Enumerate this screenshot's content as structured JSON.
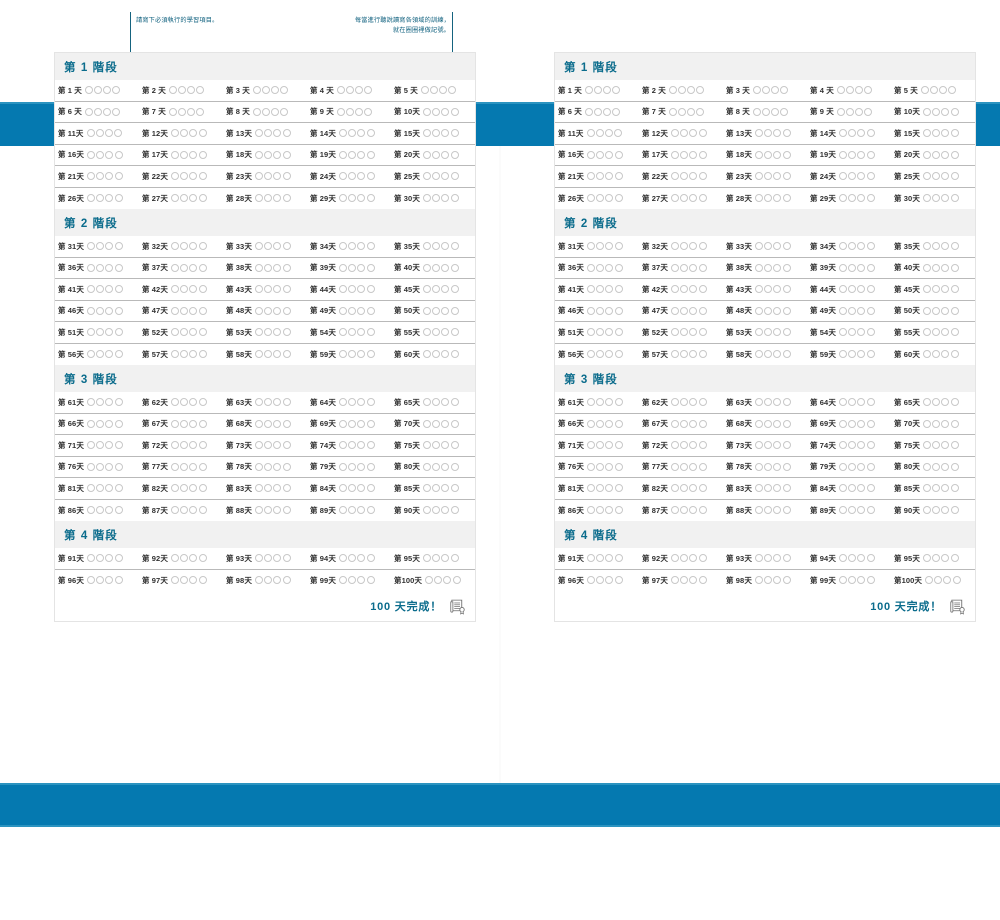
{
  "theme": {
    "band_blue": "#0579b0",
    "band_edge": "#2b93c0",
    "heading_teal": "#0b6c8c",
    "annotation_teal": "#0d5f7d",
    "stage_header_bg": "#f1f1f1",
    "circle_border": "#c8c8c8",
    "row_rule": "#b9b9b9",
    "day_text": "#303030"
  },
  "annotations": {
    "left_note": "請寫下必須執行的學習項目。",
    "right_note": "每當進行聽說讀寫各領域的訓練，\n就在圈圈裡做記號。"
  },
  "tracker": {
    "marks_per_day": 4,
    "footer_text": "100 天完成！",
    "footer_icon": "certificate-icon",
    "day_prefix": "第",
    "day_suffix": "天",
    "stages": [
      {
        "label": "第 1 階段",
        "days": [
          1,
          2,
          3,
          4,
          5,
          6,
          7,
          8,
          9,
          10,
          11,
          12,
          13,
          14,
          15,
          16,
          17,
          18,
          19,
          20,
          21,
          22,
          23,
          24,
          25,
          26,
          27,
          28,
          29,
          30
        ]
      },
      {
        "label": "第 2 階段",
        "days": [
          31,
          32,
          33,
          34,
          35,
          36,
          37,
          38,
          39,
          40,
          41,
          42,
          43,
          44,
          45,
          46,
          47,
          48,
          49,
          50,
          51,
          52,
          53,
          54,
          55,
          56,
          57,
          58,
          59,
          60
        ]
      },
      {
        "label": "第 3 階段",
        "days": [
          61,
          62,
          63,
          64,
          65,
          66,
          67,
          68,
          69,
          70,
          71,
          72,
          73,
          74,
          75,
          76,
          77,
          78,
          79,
          80,
          81,
          82,
          83,
          84,
          85,
          86,
          87,
          88,
          89,
          90
        ]
      },
      {
        "label": "第 4 階段",
        "days": [
          91,
          92,
          93,
          94,
          95,
          96,
          97,
          98,
          99,
          100
        ]
      }
    ]
  },
  "pages": [
    {
      "side": "left",
      "show_annotations": true
    },
    {
      "side": "right",
      "show_annotations": false
    }
  ]
}
